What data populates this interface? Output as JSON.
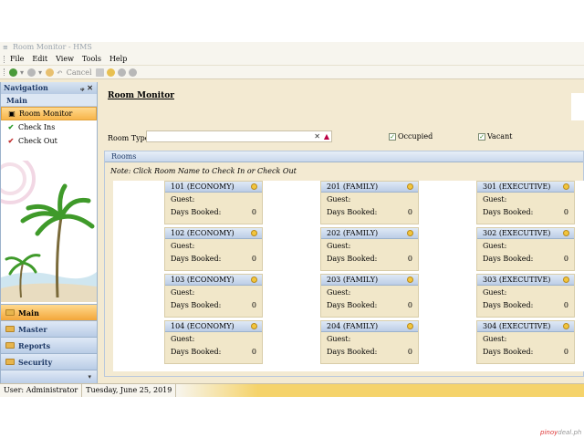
{
  "app": {
    "title": "Room Monitor - HMS"
  },
  "menu": [
    "File",
    "Edit",
    "View",
    "Tools",
    "Help"
  ],
  "toolbar": {
    "cancel_label": "Cancel"
  },
  "navigation": {
    "title": "Navigation",
    "pin": "ᵩ",
    "close": "✕",
    "section": "Main",
    "items": [
      {
        "label": "Room Monitor",
        "icon": "monitor-icon",
        "active": true
      },
      {
        "label": "Check Ins",
        "icon": "checkmark-green-icon",
        "active": false
      },
      {
        "label": "Check Out",
        "icon": "checkmark-red-icon",
        "active": false
      }
    ],
    "groups": [
      "Main",
      "Master",
      "Reports",
      "Security"
    ]
  },
  "content": {
    "title": "Room Monitor",
    "room_type_label": "Room Type:",
    "room_type_value": "",
    "filters": {
      "occupied": "Occupied",
      "vacant": "Vacant"
    },
    "rooms_title": "Rooms",
    "note": "Note: Click Room Name to Check In or Check Out",
    "guest_label": "Guest:",
    "days_label": "Days Booked:",
    "rooms": [
      {
        "name": "101 (ECONOMY)",
        "guest": "",
        "days": "0"
      },
      {
        "name": "201 (FAMILY)",
        "guest": "",
        "days": "0"
      },
      {
        "name": "301 (EXECUTIVE)",
        "guest": "",
        "days": "0"
      },
      {
        "name": "102 (ECONOMY)",
        "guest": "",
        "days": "0"
      },
      {
        "name": "202 (FAMILY)",
        "guest": "",
        "days": "0"
      },
      {
        "name": "302 (EXECUTIVE)",
        "guest": "",
        "days": "0"
      },
      {
        "name": "103 (ECONOMY)",
        "guest": "",
        "days": "0"
      },
      {
        "name": "203 (FAMILY)",
        "guest": "",
        "days": "0"
      },
      {
        "name": "303 (EXECUTIVE)",
        "guest": "",
        "days": "0"
      },
      {
        "name": "104 (ECONOMY)",
        "guest": "",
        "days": "0"
      },
      {
        "name": "204 (FAMILY)",
        "guest": "",
        "days": "0"
      },
      {
        "name": "304 (EXECUTIVE)",
        "guest": "",
        "days": "0"
      }
    ]
  },
  "status": {
    "user": "User: Administrator",
    "date": "Tuesday, June 25, 2019"
  },
  "watermark": {
    "brand": "pinoy",
    "rest": "deal.ph"
  },
  "colors": {
    "accent_orange": "#f7b54a",
    "nav_blue": "#b9cce6",
    "panel_bg": "#f3ead2"
  }
}
